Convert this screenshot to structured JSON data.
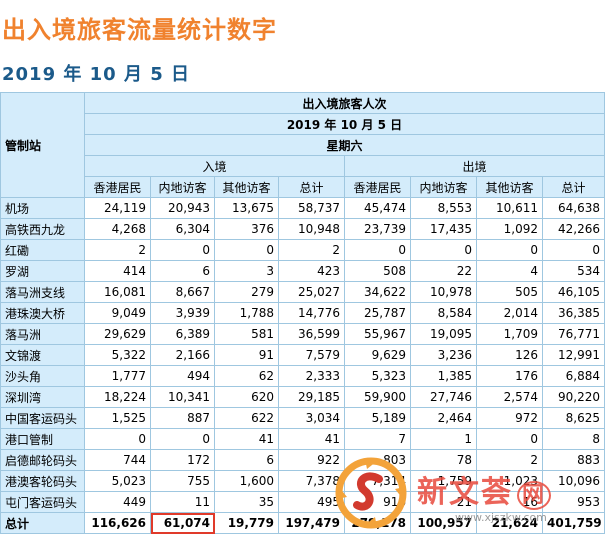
{
  "title": "出入境旅客流量统计数字",
  "subtitle": "2019 年 10 月 5 日",
  "table": {
    "station_header": "管制站",
    "caption": "出入境旅客人次",
    "date": "2019 年 10 月 5 日",
    "weekday": "星期六",
    "groups": [
      "入境",
      "出境"
    ],
    "columns": [
      "香港居民",
      "内地访客",
      "其他访客",
      "总计",
      "香港居民",
      "内地访客",
      "其他访客",
      "总计"
    ],
    "rows": [
      {
        "station": "机场",
        "values": [
          "24,119",
          "20,943",
          "13,675",
          "58,737",
          "45,474",
          "8,553",
          "10,611",
          "64,638"
        ]
      },
      {
        "station": "高铁西九龙",
        "values": [
          "4,268",
          "6,304",
          "376",
          "10,948",
          "23,739",
          "17,435",
          "1,092",
          "42,266"
        ]
      },
      {
        "station": "红磡",
        "values": [
          "2",
          "0",
          "0",
          "2",
          "0",
          "0",
          "0",
          "0"
        ]
      },
      {
        "station": "罗湖",
        "values": [
          "414",
          "6",
          "3",
          "423",
          "508",
          "22",
          "4",
          "534"
        ]
      },
      {
        "station": "落马洲支线",
        "values": [
          "16,081",
          "8,667",
          "279",
          "25,027",
          "34,622",
          "10,978",
          "505",
          "46,105"
        ]
      },
      {
        "station": "港珠澳大桥",
        "values": [
          "9,049",
          "3,939",
          "1,788",
          "14,776",
          "25,787",
          "8,584",
          "2,014",
          "36,385"
        ]
      },
      {
        "station": "落马洲",
        "values": [
          "29,629",
          "6,389",
          "581",
          "36,599",
          "55,967",
          "19,095",
          "1,709",
          "76,771"
        ]
      },
      {
        "station": "文锦渡",
        "values": [
          "5,322",
          "2,166",
          "91",
          "7,579",
          "9,629",
          "3,236",
          "126",
          "12,991"
        ]
      },
      {
        "station": "沙头角",
        "values": [
          "1,777",
          "494",
          "62",
          "2,333",
          "5,323",
          "1,385",
          "176",
          "6,884"
        ]
      },
      {
        "station": "深圳湾",
        "values": [
          "18,224",
          "10,341",
          "620",
          "29,185",
          "59,900",
          "27,746",
          "2,574",
          "90,220"
        ]
      },
      {
        "station": "中国客运码头",
        "values": [
          "1,525",
          "887",
          "622",
          "3,034",
          "5,189",
          "2,464",
          "972",
          "8,625"
        ]
      },
      {
        "station": "港口管制",
        "values": [
          "0",
          "0",
          "41",
          "41",
          "7",
          "1",
          "0",
          "8"
        ]
      },
      {
        "station": "启德邮轮码头",
        "values": [
          "744",
          "172",
          "6",
          "922",
          "803",
          "78",
          "2",
          "883"
        ]
      },
      {
        "station": "港澳客轮码头",
        "values": [
          "5,023",
          "755",
          "1,600",
          "7,378",
          "7,314",
          "1,759",
          "1,023",
          "10,096"
        ]
      },
      {
        "station": "屯门客运码头",
        "values": [
          "449",
          "11",
          "35",
          "495",
          "916",
          "21",
          "16",
          "953"
        ]
      }
    ],
    "total": {
      "station": "总计",
      "values": [
        "116,626",
        "61,074",
        "19,779",
        "197,479",
        "279,178",
        "100,957",
        "21,624",
        "401,759"
      ]
    }
  },
  "watermark": {
    "text": "新文荟",
    "suffix": "网",
    "url": "www.xjszkw.com"
  },
  "colors": {
    "title": "#f0822e",
    "subtitle": "#1b5a8a",
    "header_bg": "#d4ecfb",
    "border": "#9fc7e0",
    "highlight": "#e03a2a"
  }
}
